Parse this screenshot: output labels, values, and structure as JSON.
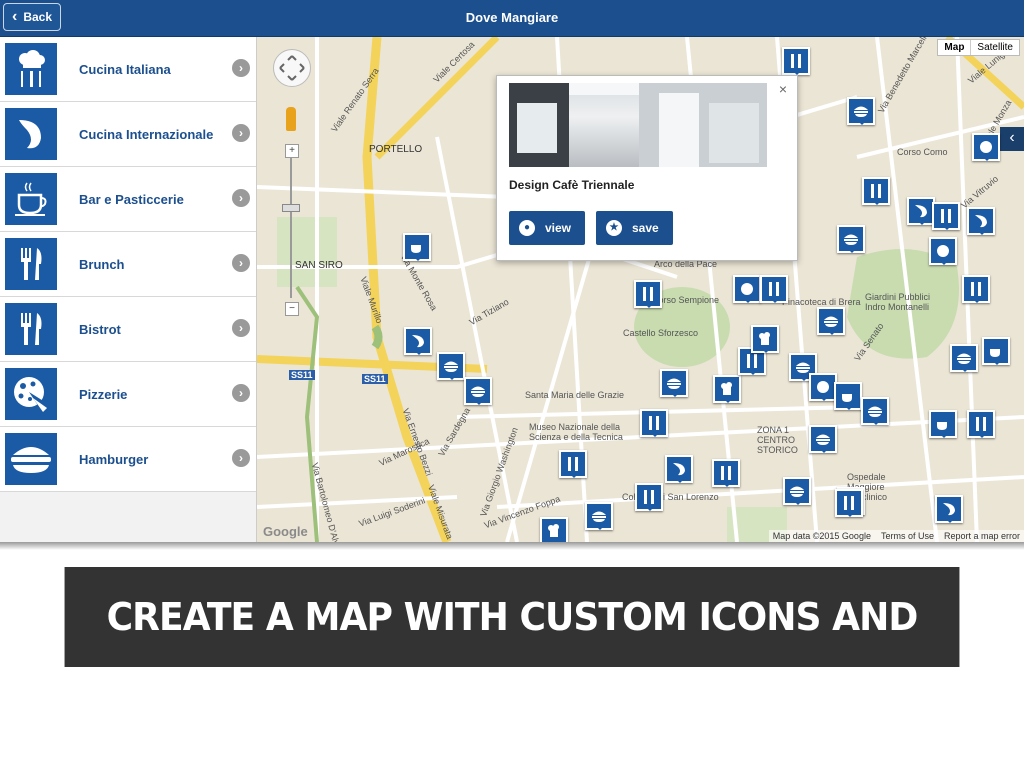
{
  "header": {
    "back_label": "Back",
    "title": "Dove Mangiare"
  },
  "categories": [
    {
      "label": "Cucina Italiana",
      "icon": "chef-hat-cutlery-icon"
    },
    {
      "label": "Cucina Internazionale",
      "icon": "pepper-icon"
    },
    {
      "label": "Bar e Pasticcerie",
      "icon": "coffee-cup-icon"
    },
    {
      "label": "Brunch",
      "icon": "fork-knife-icon"
    },
    {
      "label": "Bistrot",
      "icon": "fork-knife-icon"
    },
    {
      "label": "Pizzerie",
      "icon": "pizza-icon"
    },
    {
      "label": "Hamburger",
      "icon": "hamburger-icon"
    }
  ],
  "map": {
    "type_map": "Map",
    "type_satellite": "Satellite",
    "labels": [
      "PORTELLO",
      "SAN SIRO",
      "Viale Renato Serra",
      "Viale Certosa",
      "Viale Murillo",
      "Corso Sempione",
      "Castello Sforzesco",
      "Santa Maria delle Grazie",
      "Museo Nazionale della Scienza e della Tecnica",
      "Arco della Pace",
      "Giardini Pubblici Indro Montanelli",
      "Ospedale Maggiore Policlinico",
      "Colonne di San Lorenzo",
      "ZONA 1 CENTRO STORICO",
      "Pinacoteca di Brera",
      "Via Vincenzo Foppa",
      "Via Bartolomeo D'Alviano",
      "Via Luigi Soderini",
      "Via Marostica",
      "Via Sardegna",
      "Via Giorgio Washington",
      "Via Ernesto Bezzi",
      "Viale Misurata",
      "Via Tiziano",
      "Via Monte Rosa",
      "Via Vitruvio",
      "Viale Lunigiana",
      "Corso Como",
      "Via Benedetto Marcello",
      "Via Senato",
      "Viale Monza"
    ],
    "road_badges": [
      "SS11",
      "SS11"
    ],
    "attribution": [
      "Map data ©2015 Google",
      "Terms of Use",
      "Report a map error"
    ],
    "logo": "Google",
    "popup": {
      "name": "Design Cafè Triennale",
      "view_label": "view",
      "save_label": "save",
      "close": "×"
    }
  },
  "banner": {
    "text": "CREATE A MAP WITH CUSTOM ICONS AND CATEGORIES"
  },
  "colors": {
    "brand": "#1b4f8e",
    "icon_bg": "#1b5ba6",
    "banner_bg": "#333333"
  }
}
